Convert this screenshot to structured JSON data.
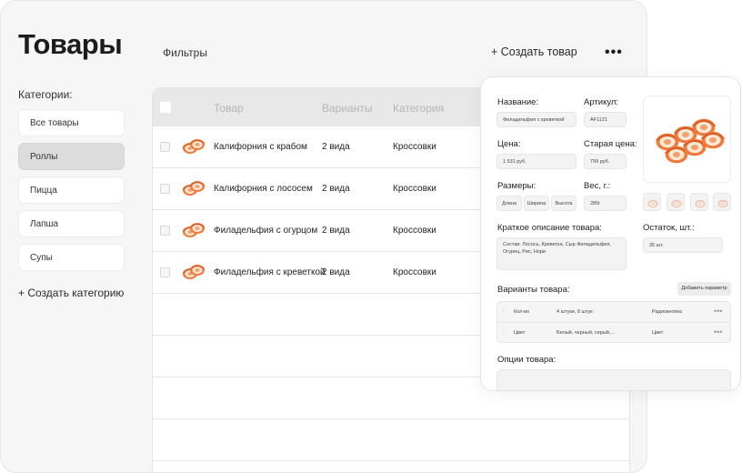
{
  "page": {
    "title": "Товары",
    "filters_label": "Фильтры",
    "create_product_label": "+ Создать товар",
    "more_icon": "•••"
  },
  "sidebar": {
    "heading": "Категории:",
    "items": [
      {
        "label": "Все товары",
        "active": false
      },
      {
        "label": "Роллы",
        "active": true
      },
      {
        "label": "Пицца",
        "active": false
      },
      {
        "label": "Лапша",
        "active": false
      },
      {
        "label": "Супы",
        "active": false
      }
    ],
    "create_category_label": "+ Создать категорию"
  },
  "table": {
    "columns": [
      "Товар",
      "Варианты",
      "Категория"
    ],
    "rows": [
      {
        "name": "Калифорния с крабом",
        "variants": "2 вида",
        "category": "Кроссовки"
      },
      {
        "name": "Калифорния с лососем",
        "variants": "2 вида",
        "category": "Кроссовки"
      },
      {
        "name": "Филадельфия с огурцом",
        "variants": "2 вида",
        "category": "Кроссовки"
      },
      {
        "name": "Филадельфия с креветкой",
        "variants": "2 вида",
        "category": "Кроссовки"
      }
    ],
    "partial_cell": "$"
  },
  "edit": {
    "name_label": "Название:",
    "name_value": "Филадельфия с креветкой",
    "sku_label": "Артикул:",
    "sku_value": "AF1121",
    "price_label": "Цена:",
    "price_value": "1 531 руб.",
    "old_price_label": "Старая цена:",
    "old_price_value": "799 руб.",
    "sizes_label": "Размеры:",
    "sizes": [
      "Длина",
      "Ширина",
      "Высота"
    ],
    "weight_label": "Вес, г.:",
    "weight_value": "280г",
    "description_label": "Краткое описание товара:",
    "description_value": "Состав: Лосось, Креветка, Сыр Филадельфия, Огурец, Рис, Нори",
    "stock_label": "Остаток, шт.:",
    "stock_value": "35 шт.",
    "variants_label": "Варианты товара:",
    "add_param_label": "Добавить параметр",
    "variants": [
      {
        "name": "Кол-во",
        "values": "4 штуки, 8 штук",
        "type": "Радиокнопка"
      },
      {
        "name": "Цвет",
        "values": "Белый, черный, серый,...",
        "type": "Цвет"
      }
    ],
    "row_more_icon": "•••",
    "grip_icon": "⁞",
    "options_label": "Опции товара:"
  },
  "colors": {
    "panel_bg": "#f6f6f6",
    "active_category": "#dcdcdc",
    "roll_orange": "#f07a3c"
  }
}
